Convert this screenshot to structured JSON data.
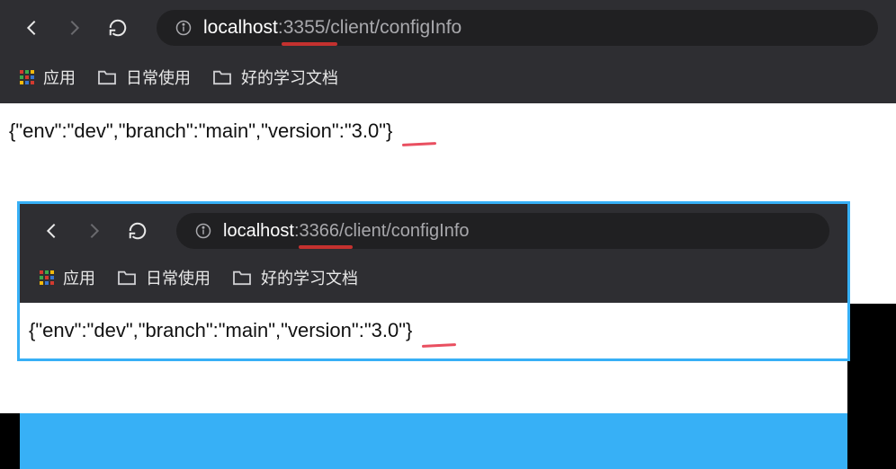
{
  "windows": [
    {
      "url": {
        "host": "localhost",
        "port": ":3355",
        "path": "/client/configInfo"
      },
      "bookmarks": {
        "apps": "应用",
        "folder1": "日常使用",
        "folder2": "好的学习文档"
      },
      "response": "{\"env\":\"dev\",\"branch\":\"main\",\"version\":\"3.0\"}"
    },
    {
      "url": {
        "host": "localhost",
        "port": ":3366",
        "path": "/client/configInfo"
      },
      "bookmarks": {
        "apps": "应用",
        "folder1": "日常使用",
        "folder2": "好的学习文档"
      },
      "response": "{\"env\":\"dev\",\"branch\":\"main\",\"version\":\"3.0\"}"
    }
  ]
}
